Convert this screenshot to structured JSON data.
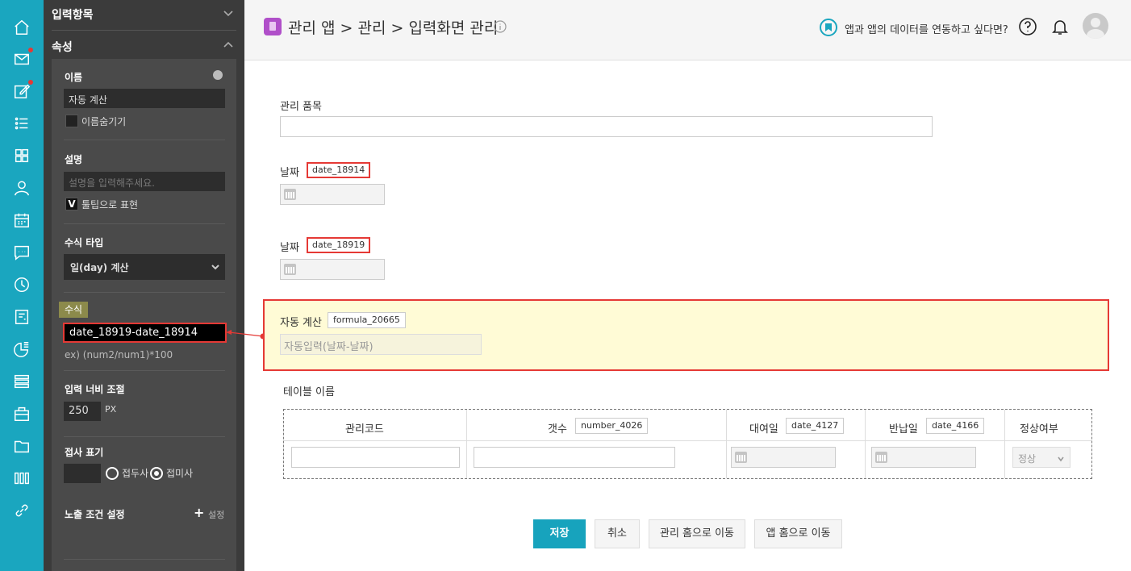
{
  "colors": {
    "rail": "#1aa6bf",
    "primary": "#17a3bd",
    "highlight": "#e53935",
    "auto_bg": "#fffbd6"
  },
  "rail": {
    "icons": [
      "home-icon",
      "mail-icon",
      "edit-icon",
      "list-icon",
      "grid-icon",
      "user-icon",
      "calendar-icon",
      "chat-icon",
      "clock-icon",
      "board-icon",
      "chart-icon",
      "stack-icon",
      "briefcase-icon",
      "folder-icon",
      "apps-icon",
      "link-icon"
    ]
  },
  "panel": {
    "section_inputs": "입력항목",
    "section_props": "속성",
    "name_label": "이름",
    "name_value": "자동 계산",
    "hide_name_label": "이름숨기기",
    "desc_label": "설명",
    "desc_placeholder": "설명을 입력해주세요.",
    "tooltip_check": "V",
    "tooltip_label": "툴팁으로 표현",
    "formula_type_label": "수식 타입",
    "formula_type_value": "일(day) 계산",
    "formula_label": "수식",
    "formula_value": "date_18919-date_18914",
    "formula_hint": "ex) (num2/num1)*100",
    "width_label": "입력 너비 조절",
    "width_value": "250",
    "width_unit": "PX",
    "affix_label": "접사 표기",
    "prefix_label": "접두사",
    "suffix_label": "접미사",
    "visibility_label": "노출 조건 설정",
    "plus_sign": "+",
    "settings_label": "설정"
  },
  "header": {
    "title": "관리 앱 > 관리 > 입력화면 관리",
    "link_text": "앱과 앱의 데이터를 연동하고 싶다면?"
  },
  "form": {
    "item_label": "관리 품목",
    "date1_label": "날짜",
    "date1_tag": "date_18914",
    "date2_label": "날짜",
    "date2_tag": "date_18919",
    "auto_label": "자동 계산",
    "auto_tag": "formula_20665",
    "auto_placeholder": "자동입력(날짜-날짜)",
    "table_label": "테이블 이름",
    "columns": [
      {
        "label": "관리코드",
        "tag": ""
      },
      {
        "label": "갯수",
        "tag": "number_4026"
      },
      {
        "label": "대여일",
        "tag": "date_4127"
      },
      {
        "label": "반납일",
        "tag": "date_4166"
      },
      {
        "label": "정상여부",
        "tag": ""
      }
    ],
    "status_value": "정상"
  },
  "buttons": {
    "save": "저장",
    "cancel": "취소",
    "manage_home": "관리 홈으로 이동",
    "app_home": "앱 홈으로 이동"
  }
}
